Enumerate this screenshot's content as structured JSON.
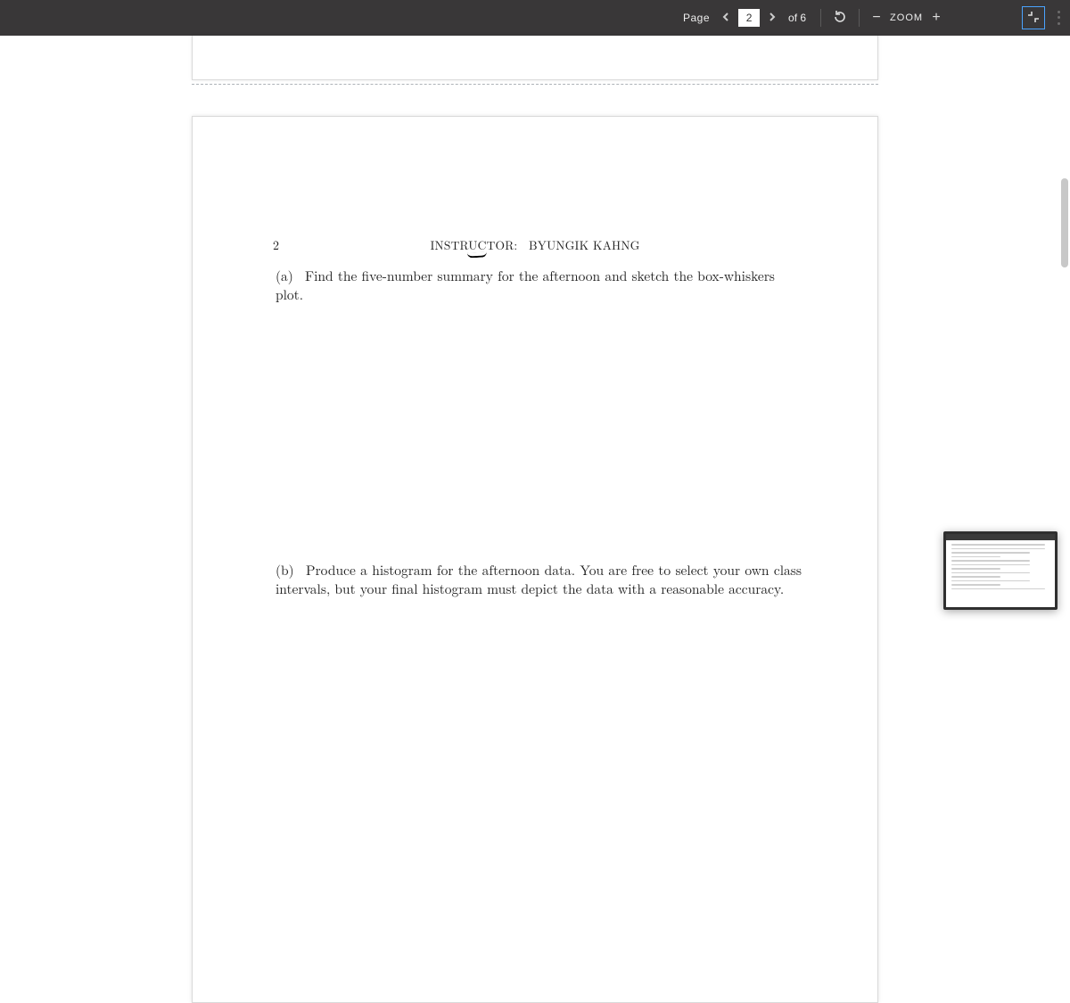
{
  "toolbar": {
    "page_label": "Page",
    "current_page": "2",
    "of_label": "of 6",
    "zoom_label": "ZOOM"
  },
  "document": {
    "page_number": "2",
    "instructor_label": "INSTRUCTOR:",
    "instructor_name": "BYUNGIK KAHNG",
    "item_a_label": "(a)",
    "item_a_text": "Find the five-number summary for the afternoon and sketch the box-whiskers plot.",
    "item_b_label": "(b)",
    "item_b_text": "Produce a histogram for the afternoon data.  You are free to select your own class intervals, but your final histogram must depict the data with a reasonable accuracy."
  }
}
